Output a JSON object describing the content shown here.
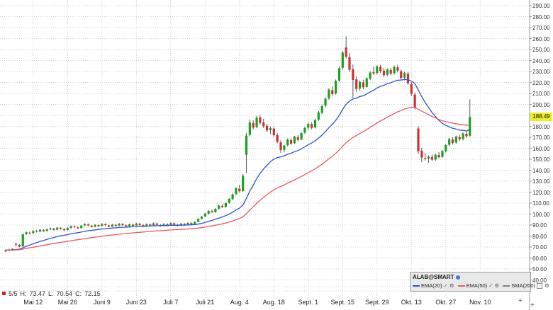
{
  "last_price_tag": "188.49",
  "ohlc_readout": {
    "bar": "5/5",
    "h_label": "H:",
    "high": "73.47",
    "l_label": "L:",
    "low": "70.54",
    "c_label": "C:",
    "close": "72.15"
  },
  "legend": {
    "title": "ALAB@SMART",
    "items": [
      {
        "label": "EMA(20)",
        "color": "#2d52cc",
        "checked": true
      },
      {
        "label": "EMA(50)",
        "color": "#ee5560",
        "checked": true
      },
      {
        "label": "SMA(200)",
        "color": "#808080",
        "checked": false
      }
    ]
  },
  "icons": {
    "plus_time": "+",
    "plus_price": "+",
    "check": "✓",
    "gear": "⚙"
  },
  "colors": {
    "up": "#19a11f",
    "down": "#d13030",
    "wick": "#4a4a4a",
    "grid": "#cfcfcf",
    "axis_line": "#9a9a9a",
    "last_price_bg": "#eded2c",
    "axis_text": "#333333"
  },
  "chart_data": {
    "type": "candlestick",
    "symbol": "ALAB@SMART",
    "last_price": 188.49,
    "y_axis": {
      "min": 40,
      "max": 290,
      "step": 10,
      "tick_format": "0.00"
    },
    "x_ticks": [
      {
        "label": "Mai 12",
        "index": 8
      },
      {
        "label": "Mai 26",
        "index": 18
      },
      {
        "label": "Juni 9",
        "index": 28
      },
      {
        "label": "Juni 23",
        "index": 38
      },
      {
        "label": "Juli 7",
        "index": 48
      },
      {
        "label": "Juli 21",
        "index": 58
      },
      {
        "label": "Aug. 4",
        "index": 68
      },
      {
        "label": "Aug. 18",
        "index": 78
      },
      {
        "label": "Sept. 1",
        "index": 88
      },
      {
        "label": "Sept. 15",
        "index": 98
      },
      {
        "label": "Sept. 29",
        "index": 108
      },
      {
        "label": "Okt. 13",
        "index": 118
      },
      {
        "label": "Okt. 27",
        "index": 128
      },
      {
        "label": "Nov. 10",
        "index": 138
      }
    ],
    "overlays": [
      {
        "label": "EMA(20)",
        "type": "ema",
        "period": 20,
        "color": "#2d52cc"
      },
      {
        "label": "EMA(50)",
        "type": "ema",
        "period": 50,
        "color": "#ee5560"
      },
      {
        "label": "SMA(200)",
        "type": "sma",
        "period": 200,
        "color": "#808080"
      }
    ],
    "candles": [
      [
        66.0,
        67.9,
        65.2,
        67.2
      ],
      [
        67.3,
        68.4,
        66.1,
        66.6
      ],
      [
        66.8,
        68.9,
        66.2,
        68.3
      ],
      [
        73.2,
        73.47,
        70.54,
        72.15
      ],
      [
        72.0,
        72.6,
        69.8,
        70.4
      ],
      [
        70.6,
        82.3,
        70.1,
        81.6
      ],
      [
        81.8,
        84.2,
        80.9,
        83.4
      ],
      [
        83.0,
        84.1,
        81.7,
        82.5
      ],
      [
        82.7,
        85.3,
        82.0,
        84.6
      ],
      [
        84.4,
        85.6,
        83.2,
        83.9
      ],
      [
        84.0,
        86.4,
        83.5,
        85.7
      ],
      [
        85.5,
        86.2,
        83.8,
        84.4
      ],
      [
        84.6,
        86.9,
        84.1,
        86.1
      ],
      [
        86.3,
        87.8,
        85.4,
        87.0
      ],
      [
        86.8,
        87.5,
        84.9,
        85.6
      ],
      [
        85.8,
        88.3,
        85.2,
        87.6
      ],
      [
        87.4,
        88.2,
        85.9,
        86.5
      ],
      [
        86.3,
        87.1,
        84.6,
        85.2
      ],
      [
        85.4,
        88.0,
        85.0,
        87.3
      ],
      [
        87.5,
        89.6,
        86.8,
        89.0
      ],
      [
        88.8,
        89.7,
        87.2,
        88.1
      ],
      [
        87.9,
        88.8,
        86.4,
        87.0
      ],
      [
        87.2,
        90.1,
        86.8,
        89.5
      ],
      [
        89.7,
        91.6,
        89.0,
        90.9
      ],
      [
        90.6,
        91.4,
        88.9,
        89.6
      ],
      [
        89.4,
        90.2,
        87.7,
        88.3
      ],
      [
        88.5,
        90.9,
        88.0,
        90.2
      ],
      [
        90.0,
        90.8,
        88.4,
        89.1
      ],
      [
        89.3,
        91.8,
        88.8,
        91.0
      ],
      [
        90.8,
        91.6,
        89.2,
        89.9
      ],
      [
        89.7,
        90.5,
        87.9,
        88.5
      ],
      [
        88.7,
        91.1,
        88.2,
        90.4
      ],
      [
        90.2,
        91.0,
        88.5,
        89.2
      ],
      [
        89.4,
        91.9,
        89.0,
        91.2
      ],
      [
        91.0,
        91.8,
        89.3,
        90.0
      ],
      [
        89.8,
        90.6,
        88.1,
        88.7
      ],
      [
        88.9,
        91.3,
        88.4,
        90.6
      ],
      [
        90.4,
        91.2,
        88.7,
        89.4
      ],
      [
        89.6,
        92.1,
        89.1,
        91.4
      ],
      [
        91.2,
        92.0,
        89.5,
        90.1
      ],
      [
        90.0,
        90.8,
        88.3,
        88.9
      ],
      [
        89.1,
        91.5,
        88.6,
        90.8
      ],
      [
        90.6,
        91.4,
        88.9,
        89.6
      ],
      [
        89.8,
        92.3,
        89.3,
        91.6
      ],
      [
        91.4,
        92.2,
        89.7,
        90.3
      ],
      [
        90.1,
        91.0,
        88.5,
        89.1
      ],
      [
        89.3,
        91.7,
        88.8,
        91.0
      ],
      [
        90.8,
        91.6,
        89.1,
        89.8
      ],
      [
        90.0,
        92.5,
        89.5,
        91.8
      ],
      [
        91.6,
        92.4,
        89.9,
        90.5
      ],
      [
        90.3,
        91.2,
        88.7,
        89.3
      ],
      [
        89.5,
        91.9,
        89.0,
        91.2
      ],
      [
        91.0,
        91.8,
        89.3,
        90.0
      ],
      [
        90.2,
        92.7,
        89.7,
        92.0
      ],
      [
        91.8,
        92.6,
        90.1,
        90.7
      ],
      [
        90.5,
        93.4,
        90.0,
        92.8
      ],
      [
        93.0,
        96.2,
        92.5,
        95.6
      ],
      [
        95.8,
        98.4,
        95.0,
        97.7
      ],
      [
        97.9,
        101.2,
        97.2,
        100.5
      ],
      [
        100.3,
        103.6,
        99.6,
        102.9
      ],
      [
        102.6,
        104.0,
        100.8,
        101.6
      ],
      [
        101.8,
        105.4,
        101.2,
        104.7
      ],
      [
        104.9,
        108.6,
        104.1,
        107.8
      ],
      [
        107.5,
        109.0,
        105.6,
        106.4
      ],
      [
        106.6,
        110.8,
        106.0,
        110.1
      ],
      [
        110.3,
        114.6,
        109.5,
        113.9
      ],
      [
        113.6,
        118.8,
        112.9,
        118.0
      ],
      [
        118.2,
        124.5,
        117.4,
        123.6
      ],
      [
        123.2,
        126.8,
        119.6,
        120.8
      ],
      [
        121.0,
        136.4,
        120.2,
        135.1
      ],
      [
        154.0,
        174.0,
        137.5,
        171.5
      ],
      [
        172.3,
        186.2,
        170.8,
        183.6
      ],
      [
        183.0,
        185.4,
        176.9,
        178.8
      ],
      [
        179.4,
        189.6,
        178.2,
        187.9
      ],
      [
        188.2,
        190.4,
        181.5,
        183.2
      ],
      [
        183.6,
        186.8,
        178.4,
        180.1
      ],
      [
        180.5,
        182.2,
        174.6,
        176.3
      ],
      [
        176.6,
        179.8,
        172.9,
        178.4
      ],
      [
        178.0,
        179.2,
        170.6,
        171.9
      ],
      [
        172.2,
        173.8,
        164.5,
        165.8
      ],
      [
        165.4,
        167.2,
        155.8,
        158.3
      ],
      [
        158.6,
        163.4,
        156.2,
        162.5
      ],
      [
        162.8,
        168.9,
        161.7,
        167.8
      ],
      [
        167.4,
        169.2,
        162.8,
        164.2
      ],
      [
        164.6,
        171.4,
        163.9,
        170.6
      ],
      [
        170.2,
        172.0,
        166.3,
        167.6
      ],
      [
        168.0,
        174.8,
        167.2,
        173.9
      ],
      [
        174.2,
        179.6,
        173.0,
        178.5
      ],
      [
        178.8,
        183.4,
        176.9,
        182.3
      ],
      [
        182.0,
        183.8,
        177.2,
        178.6
      ],
      [
        179.0,
        186.9,
        178.1,
        185.8
      ],
      [
        186.2,
        194.0,
        185.0,
        192.7
      ],
      [
        192.3,
        199.8,
        190.9,
        198.4
      ],
      [
        198.8,
        206.4,
        197.3,
        205.2
      ],
      [
        205.6,
        214.8,
        204.2,
        213.5
      ],
      [
        213.0,
        216.2,
        207.8,
        209.4
      ],
      [
        209.8,
        222.6,
        208.9,
        221.4
      ],
      [
        221.8,
        234.2,
        220.4,
        233.0
      ],
      [
        233.4,
        248.6,
        231.8,
        247.2
      ],
      [
        252.0,
        262.0,
        241.8,
        243.5
      ],
      [
        243.0,
        246.8,
        229.4,
        231.6
      ],
      [
        232.0,
        236.4,
        205.8,
        222.3
      ],
      [
        222.8,
        225.6,
        211.4,
        214.0
      ],
      [
        214.4,
        221.8,
        212.6,
        220.5
      ],
      [
        220.0,
        222.4,
        213.8,
        215.6
      ],
      [
        216.0,
        224.6,
        215.2,
        223.8
      ],
      [
        223.4,
        230.2,
        222.1,
        229.0
      ],
      [
        229.4,
        234.6,
        226.8,
        228.2
      ],
      [
        228.6,
        235.8,
        227.4,
        234.6
      ],
      [
        234.2,
        236.0,
        228.6,
        230.4
      ],
      [
        230.8,
        233.4,
        224.9,
        226.6
      ],
      [
        227.0,
        232.8,
        225.8,
        231.9
      ],
      [
        231.4,
        233.2,
        226.4,
        228.0
      ],
      [
        228.4,
        235.4,
        227.2,
        234.2
      ],
      [
        233.8,
        236.2,
        229.1,
        230.8
      ],
      [
        230.2,
        231.8,
        222.4,
        224.0
      ],
      [
        224.4,
        229.6,
        221.8,
        228.6
      ],
      [
        228.0,
        229.4,
        217.6,
        219.2
      ],
      [
        218.5,
        220.2,
        207.8,
        209.6
      ],
      [
        209.0,
        210.8,
        195.4,
        197.2
      ],
      [
        178.0,
        180.2,
        154.8,
        157.3
      ],
      [
        157.8,
        160.4,
        147.2,
        151.6
      ],
      [
        151.2,
        155.8,
        148.9,
        150.4
      ],
      [
        150.8,
        153.6,
        146.8,
        152.2
      ],
      [
        152.0,
        154.4,
        148.2,
        149.6
      ],
      [
        149.8,
        155.2,
        148.4,
        154.1
      ],
      [
        153.8,
        156.6,
        150.9,
        151.8
      ],
      [
        152.2,
        158.4,
        151.4,
        157.6
      ],
      [
        157.2,
        163.8,
        156.1,
        162.9
      ],
      [
        163.2,
        169.4,
        162.0,
        168.3
      ],
      [
        168.0,
        170.2,
        163.4,
        164.8
      ],
      [
        165.2,
        171.6,
        164.3,
        170.7
      ],
      [
        170.3,
        172.4,
        166.8,
        168.1
      ],
      [
        168.5,
        174.6,
        167.2,
        173.5
      ],
      [
        173.2,
        175.8,
        169.4,
        170.9
      ],
      [
        171.4,
        204.6,
        170.6,
        188.49
      ]
    ]
  }
}
